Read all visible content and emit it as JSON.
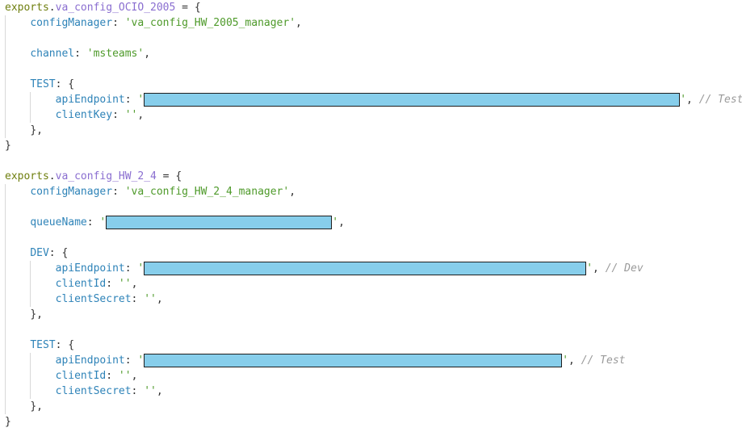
{
  "code": {
    "block1": {
      "exports": "exports",
      "dot": ".",
      "name": "va_config_OCIO_2005",
      "assign": " = {",
      "config_key": "configManager",
      "config_value": "'va_config_HW_2005_manager'",
      "channel_key": "channel",
      "channel_value": "'msteams'",
      "env_key": "TEST",
      "api_key": "apiEndpoint",
      "api_comment": "// Test",
      "client_key_key": "clientKey",
      "client_key_value": "''",
      "env_close": "},",
      "close": "}"
    },
    "block2": {
      "exports": "exports",
      "dot": ".",
      "name": "va_config_HW_2_4",
      "assign": " = {",
      "config_key": "configManager",
      "config_value": "'va_config_HW_2_4_manager'",
      "queue_key": "queueName",
      "dev_key": "DEV",
      "dev_api_key": "apiEndpoint",
      "dev_comment": "// Dev",
      "dev_client_id_key": "clientId",
      "dev_client_id_value": "''",
      "dev_client_secret_key": "clientSecret",
      "dev_client_secret_value": "''",
      "test_key": "TEST",
      "test_api_key": "apiEndpoint",
      "test_comment": "// Test",
      "test_client_id_key": "clientId",
      "test_client_id_value": "''",
      "test_client_secret_key": "clientSecret",
      "test_client_secret_value": "''",
      "env_close": "},",
      "close": "}"
    }
  },
  "colors": {
    "keyword": "#6f7f0f",
    "identifier": "#8a6ed0",
    "property": "#2e83b8",
    "string": "#4e9a2a",
    "comment": "#9a9a9a",
    "redaction_fill": "#87ceeb",
    "redaction_border": "#1e1e1e"
  }
}
